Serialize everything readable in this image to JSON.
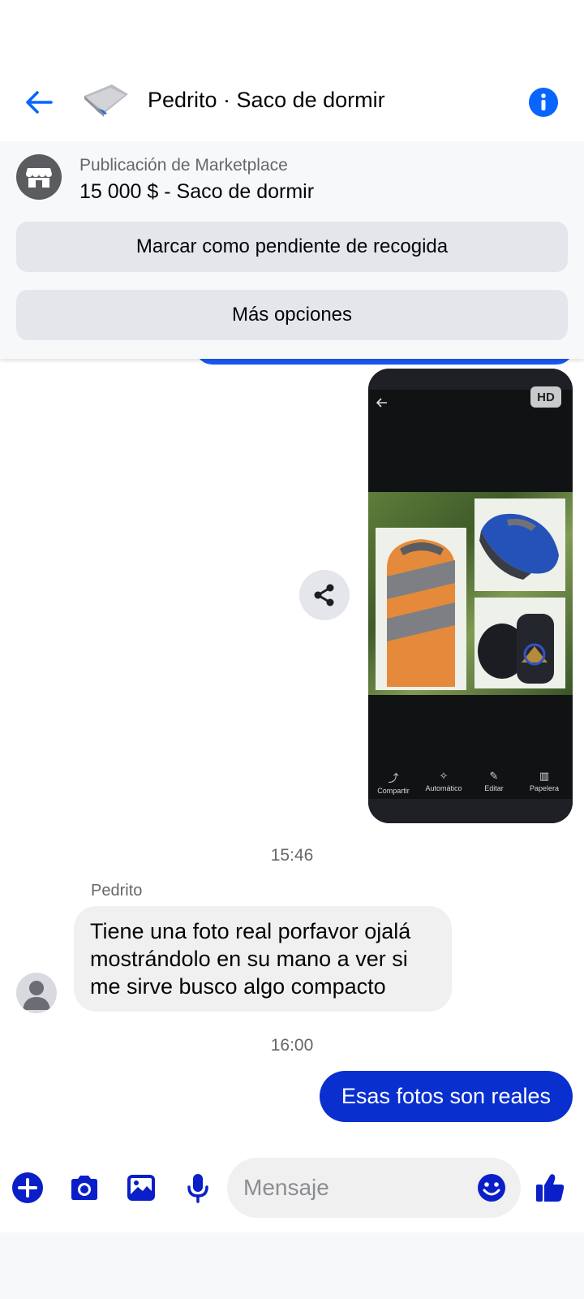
{
  "header": {
    "title": "Pedrito · Saco de dormir"
  },
  "marketplace": {
    "label": "Publicación de Marketplace",
    "price_title": "15 000 $ - Saco de dormir",
    "pickup_button": "Marcar como pendiente de recogida",
    "more_button": "Más opciones"
  },
  "image_message": {
    "hd_badge": "HD",
    "tools": [
      "Compartir",
      "Automático",
      "Editar",
      "Papelera"
    ]
  },
  "messages": {
    "time1": "15:46",
    "sender": "Pedrito",
    "incoming_text": "Tiene una foto real porfavor ojalá mostrándolo en su mano a ver si me sirve busco algo compacto",
    "time2": "16:00",
    "outgoing_text": "Esas fotos son reales"
  },
  "composer": {
    "placeholder": "Mensaje"
  },
  "colors": {
    "accent": "#0866ff",
    "outgoing_bubble": "#0a2fcf",
    "composer_icons": "#0a1fc8"
  }
}
